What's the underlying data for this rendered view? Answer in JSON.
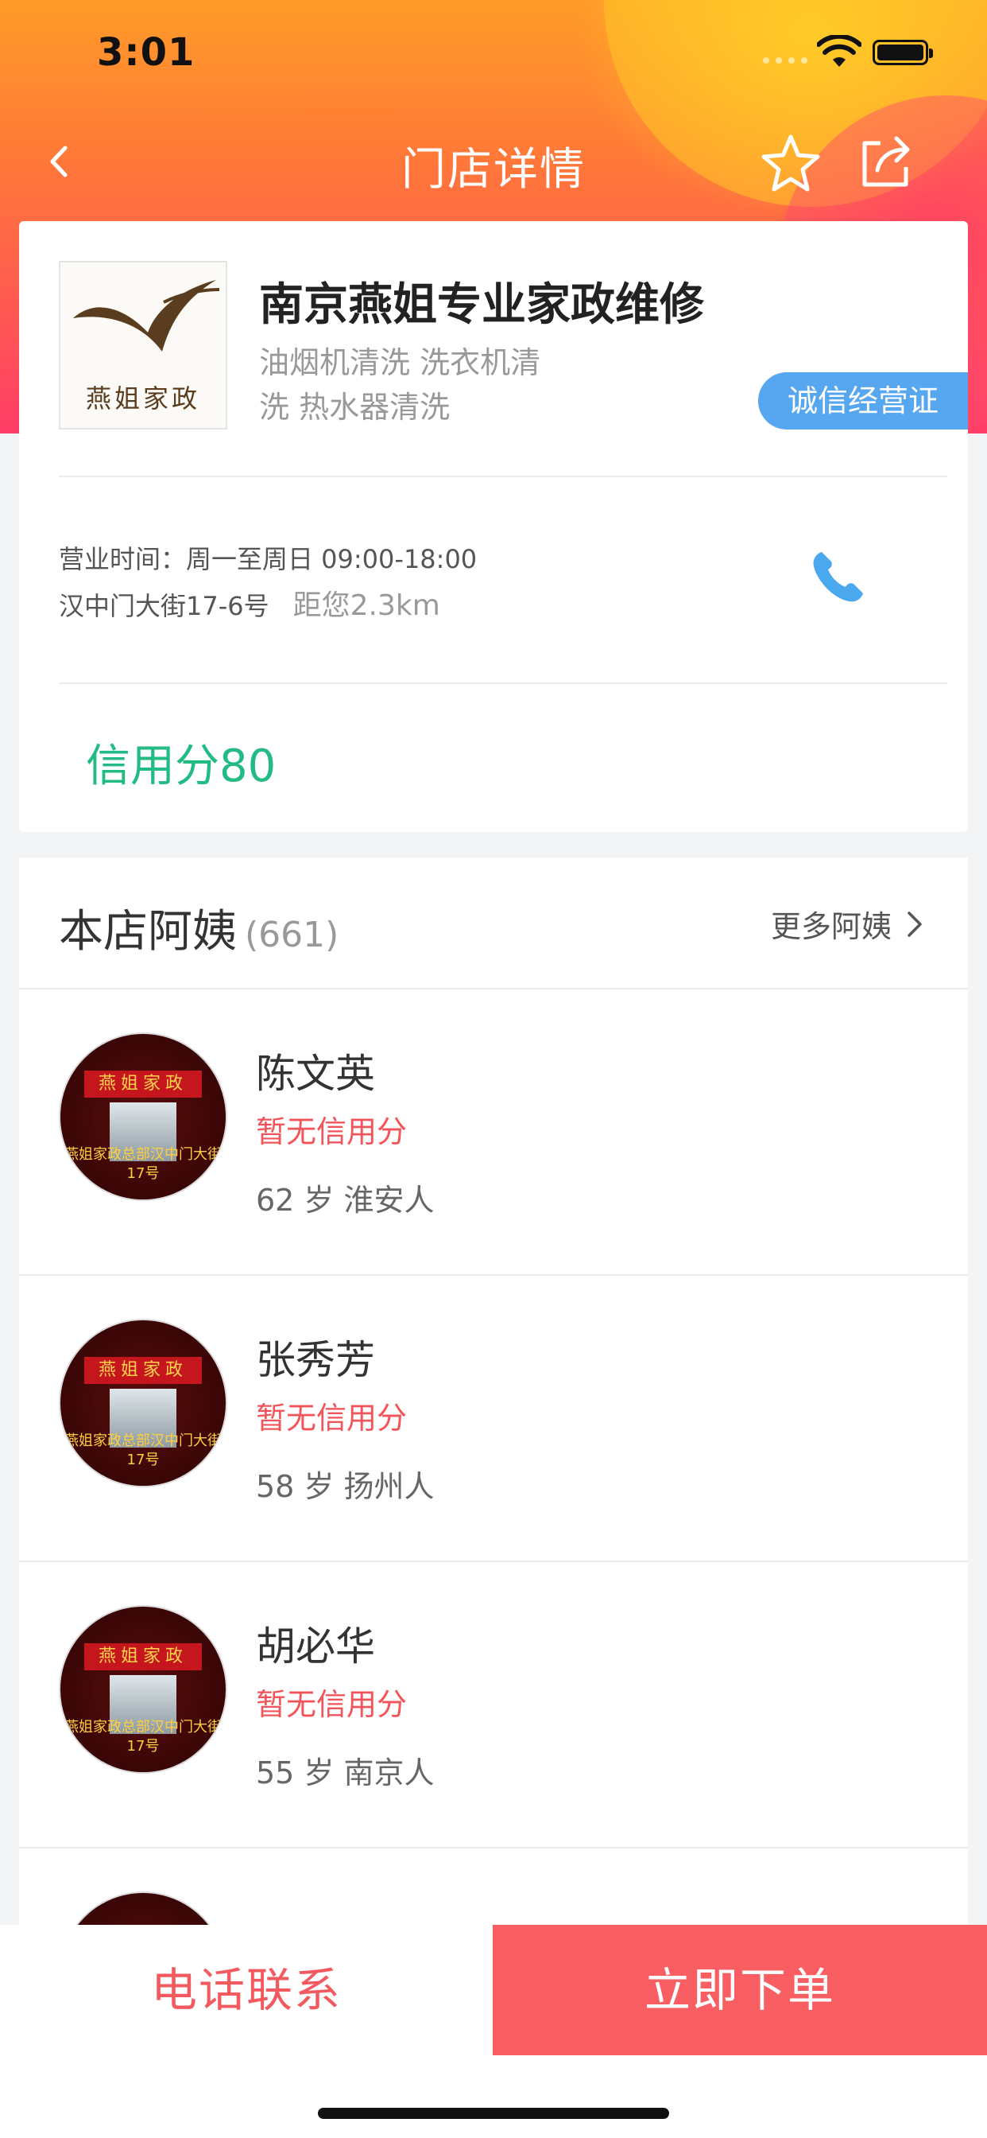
{
  "status_bar": {
    "time": "3:01"
  },
  "nav": {
    "title": "门店详情"
  },
  "store": {
    "name": "南京燕姐专业家政维修",
    "services_line1": "油烟机清洗 洗衣机清",
    "services_line2": "洗 热水器清洗",
    "badge": "诚信经营证",
    "logo_text": "燕姐家政",
    "hours": "营业时间：周一至周日 09:00-18:00",
    "address": "汉中门大街17-6号",
    "distance": "距您2.3km",
    "credit_score": "信用分80"
  },
  "aunts": {
    "title": "本店阿姨",
    "count": "(661)",
    "more": "更多阿姨",
    "avatar_sign": "燕姐家政",
    "avatar_caption": "燕姐家政总部汉中门大街17号",
    "items": [
      {
        "name": "陈文英",
        "credit": "暂无信用分",
        "info": "62 岁  淮安人"
      },
      {
        "name": "张秀芳",
        "credit": "暂无信用分",
        "info": "58 岁  扬州人"
      },
      {
        "name": "胡必华",
        "credit": "暂无信用分",
        "info": "55 岁  南京人"
      }
    ]
  },
  "bottom": {
    "call_label": "电话联系",
    "order_label": "立即下单"
  },
  "colors": {
    "accent_red": "#f85e62",
    "credit_green": "#23bb84",
    "badge_blue": "#57a6f0"
  }
}
